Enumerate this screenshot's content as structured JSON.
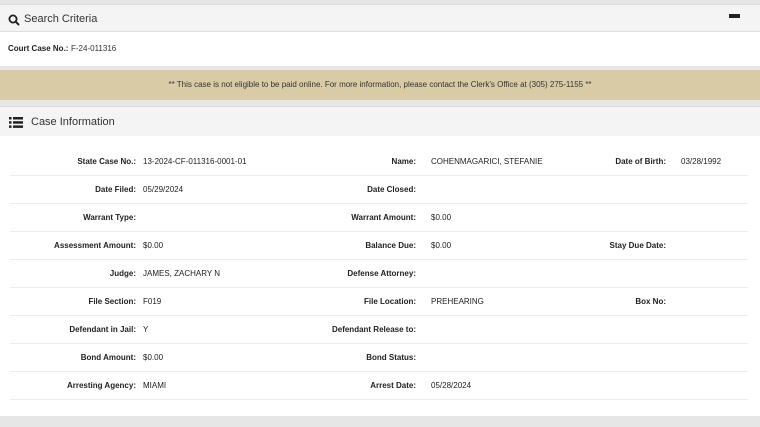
{
  "search_criteria": {
    "title": "Search Criteria",
    "court_case_label": "Court Case No.:",
    "court_case_value": "F-24-011316"
  },
  "notice": "** This case is not eligible to be paid online. For more information, please contact the Clerk's Office at (305) 275-1155 **",
  "case_info": {
    "title": "Case Information",
    "rows": [
      {
        "l1": "State Case No.:",
        "v1": "13-2024-CF-011316-0001-01",
        "l2": "Name:",
        "v2": "COHENMAGARICI, STEFANIE",
        "l3": "Date of Birth:",
        "v3": "03/28/1992"
      },
      {
        "l1": "Date Filed:",
        "v1": "05/29/2024",
        "l2": "Date Closed:",
        "v2": "",
        "l3": "",
        "v3": ""
      },
      {
        "l1": "Warrant Type:",
        "v1": "",
        "l2": "Warrant Amount:",
        "v2": "$0.00",
        "l3": "",
        "v3": ""
      },
      {
        "l1": "Assessment Amount:",
        "v1": "$0.00",
        "l2": "Balance Due:",
        "v2": "$0.00",
        "l3": "Stay Due Date:",
        "v3": ""
      },
      {
        "l1": "Judge:",
        "v1": "JAMES, ZACHARY N",
        "l2": "Defense Attorney:",
        "v2": "",
        "l3": "",
        "v3": ""
      },
      {
        "l1": "File Section:",
        "v1": "F019",
        "l2": "File Location:",
        "v2": "PREHEARING",
        "l3": "Box No:",
        "v3": ""
      },
      {
        "l1": "Defendant in Jail:",
        "v1": "Y",
        "l2": "Defendant Release to:",
        "v2": "",
        "l3": "",
        "v3": ""
      },
      {
        "l1": "Bond Amount:",
        "v1": "$0.00",
        "l2": "Bond Status:",
        "v2": "",
        "l3": "",
        "v3": ""
      },
      {
        "l1": "Arresting Agency:",
        "v1": "MIAMI",
        "l2": "Arrest Date:",
        "v2": "05/28/2024",
        "l3": "",
        "v3": ""
      }
    ]
  }
}
